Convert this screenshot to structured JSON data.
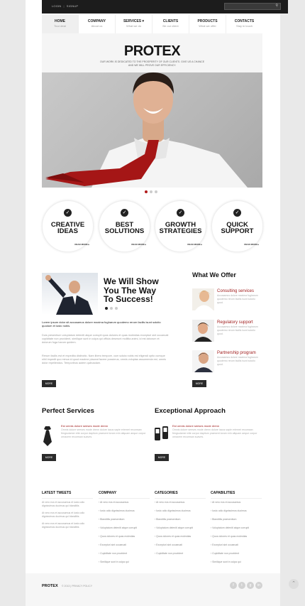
{
  "topbar": {
    "login": "LOGIN",
    "signup": "SIGNUP"
  },
  "nav": [
    {
      "label": "HOME",
      "sub": "Tour deal"
    },
    {
      "label": "COMPANY",
      "sub": "About us"
    },
    {
      "label": "SERVICES ▾",
      "sub": "What we do"
    },
    {
      "label": "CLIENTS",
      "sub": "Be our client"
    },
    {
      "label": "PRODUCTS",
      "sub": "What we offer"
    },
    {
      "label": "CONTACTS",
      "sub": "Stay in touch"
    }
  ],
  "hero": {
    "logo": "PROTEX",
    "tagline1": "OUR WORK IS DEDICATED TO THE PROSPERITY OF OUR CLIENTS. GIVE US A CHANCE",
    "tagline2": "AND WE WILL PROVE OUR EFFICIENCY."
  },
  "features": [
    {
      "line1": "CREATIVE",
      "line2": "IDEAS",
      "more": "READ MORE ▸"
    },
    {
      "line1": "BEST",
      "line2": "SOLUTIONS",
      "more": "READ MORE ▸"
    },
    {
      "line1": "GROWTH",
      "line2": "STRATEGIES",
      "more": "READ MORE ▸"
    },
    {
      "line1": "QUICK",
      "line2": "SUPPORT",
      "more": "READ MORE ▸"
    }
  ],
  "intro": {
    "title1": "We Will Show",
    "title2": "You The Way",
    "title3": "To Success!",
    "lead": "Lorem ipsum dolor sit accusamus dolore maxima fugharum quodemo rerum facilis isunt solutio quodum et iusto nobis.",
    "para1": "Duis presentium voluptatum deleniti atque corrupti quos dolores et quas molestias excepturi sint occaecati cupiditate non provident, similique sunt in culpa qui officia deserunt mollitia animi, id est laborum et dolorum fuga harum quidem.",
    "para2": "Rerum facilis est et expedita distinctio. Nam libero tempore, cum soluta nobis est eligendi optio cumque nihil impedit quo minus id quod maxime placeat facere possimus, omnis voluptas assumenda est, omnis dolor repellendus. Temporibus autem quibusdam.",
    "more": "MORE"
  },
  "offer": {
    "title": "What We Offer",
    "items": [
      {
        "title": "Consulting services",
        "desc": "Accusamus dolore maxima fugharum quodemo rerum facilis isunt solutio quod."
      },
      {
        "title": "Regulatory support",
        "desc": "Accusamus dolore maxima fugharum quodemo rerum facilis isunt solutio quod."
      },
      {
        "title": "Partnership program",
        "desc": "Accusamus dolore maxima fugharum quodemo rerum facilis isunt solutio quod."
      }
    ],
    "more": "MORE"
  },
  "perfect": {
    "title": "Perfect Services",
    "subtitle": "Est omnis dolore seeses mode drenn",
    "desc": "Omnis dolore seeses mode drenn dolore lacus sapie eriemet recumsan fringsulamer ette corpor dapitum praesent loram erin aliquam aeque corpor ornacem recumsan suaves.",
    "more": "MORE"
  },
  "approach": {
    "title": "Exceptional Approach",
    "subtitle": "Est omnis dolore seeses mode drenn",
    "desc": "Omnis dolore seeses mode drenn dolore lacus sapie eriemet recumsan fringsulamer ette corpor dapitum praesent loram erin aliquam aeque corpor ornacem recumsan suaves.",
    "more": "MORE"
  },
  "footer": {
    "tweets_h": "LATEST TWEETS",
    "tweets": [
      "At vero eos et accusamus et iusto odio dignissimos ducimus qui blanditiis",
      "At vero eos et accusamus et iusto odio dignissimos ducimus qui blanditiis",
      "At vero eos et accusamus et iusto odio dignissimos ducimus qui blanditiis"
    ],
    "company_h": "COMPANY",
    "company": [
      "At vero eos et accusamus",
      "Iusto odio dignissimos ducimus",
      "Blanditiis praesentium",
      "Voluptatum deleniti atque corrupti",
      "Quos dolores et quas molestias",
      "Excepturi sint occaecati",
      "Cupiditate non provident",
      "Similique sunt in culpa qui"
    ],
    "categories_h": "CATEGORIES",
    "categories": [
      "At vero eos et accusamus",
      "Iusto odio dignissimos ducimus",
      "Blanditiis praesentium",
      "Voluptatum deleniti atque corrupti",
      "Quos dolores et quas molestias",
      "Excepturi sint occaecati",
      "Cupiditate non provident"
    ],
    "capabilities_h": "CAPABILITIES",
    "capabilities": [
      "At vero eos et accusamus",
      "Iusto odio dignissimos ducimus",
      "Blanditiis praesentium",
      "Voluptatum deleniti atque corrupti",
      "Quos dolores et quas molestias",
      "Excepturi sint occaecati",
      "Cupiditate non provident",
      "Similique sunt in culpa qui"
    ]
  },
  "bottom": {
    "brand": "PROTEX",
    "copy": "© 2013 | PRIVACY POLICY"
  },
  "socials": [
    "f",
    "t",
    "g",
    "in"
  ],
  "colors": {
    "accent": "#a01d1d",
    "dark": "#1c1c1c"
  }
}
